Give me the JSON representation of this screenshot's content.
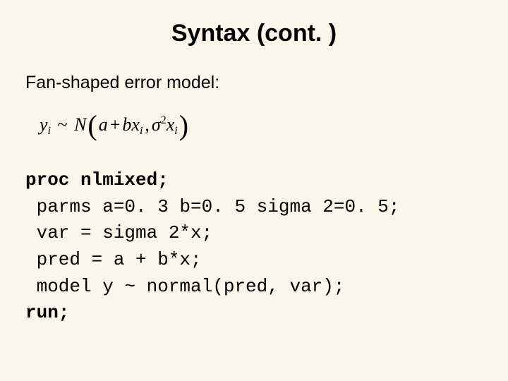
{
  "title": "Syntax (cont. )",
  "subtitle": "Fan-shaped error model:",
  "formula": {
    "y": "y",
    "y_sub": "i",
    "tilde": "~",
    "N": "N",
    "lparen": "(",
    "a": "a",
    "plus": "+",
    "b": "b",
    "x1": "x",
    "x1_sub": "i",
    "comma": ",",
    "sigma": "σ",
    "sigma_sup": "2",
    "x2": "x",
    "x2_sub": "i",
    "rparen": ")"
  },
  "code": {
    "l1": "proc nlmixed;",
    "l2": " parms a=0. 3 b=0. 5 sigma 2=0. 5;",
    "l3": " var = sigma 2*x;",
    "l4": " pred = a + b*x;",
    "l5": " model y ~ normal(pred, var);",
    "l6": "run;"
  }
}
